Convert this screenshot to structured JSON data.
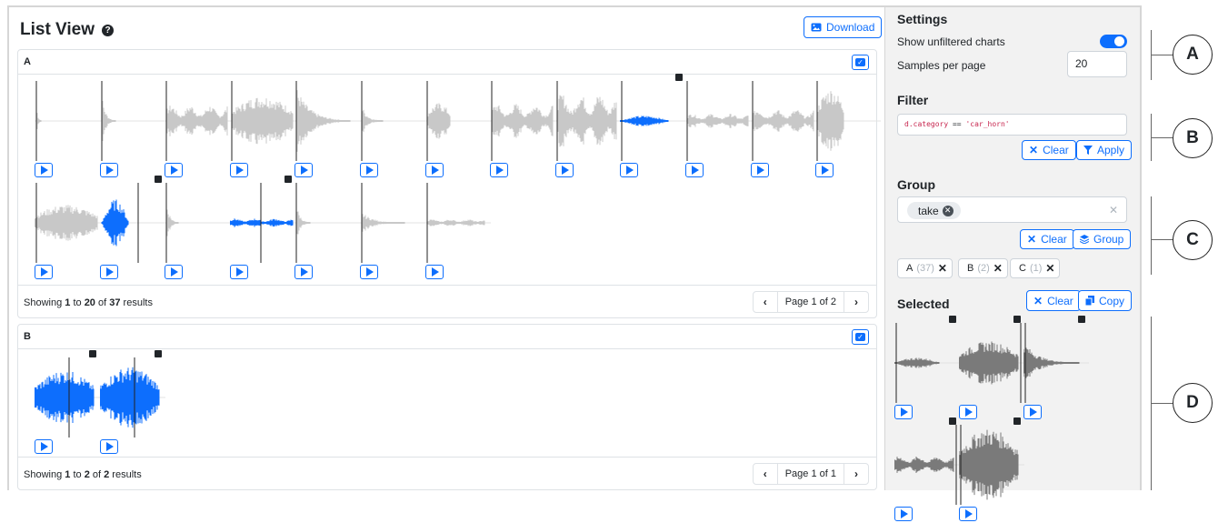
{
  "list_view": {
    "title": "List View",
    "help": "?",
    "download_label": "Download"
  },
  "groups": [
    {
      "label": "A",
      "showing_prefix": "Showing ",
      "showing_from": "1",
      "showing_to": "20",
      "showing_total": "37",
      "page_label": "Page 1 of 2"
    },
    {
      "label": "B",
      "showing_prefix": "Showing ",
      "showing_from": "1",
      "showing_to": "2",
      "showing_total": "2",
      "page_label": "Page 1 of 1"
    }
  ],
  "settings": {
    "title": "Settings",
    "show_unfiltered_label": "Show unfiltered charts",
    "show_unfiltered_on": true,
    "samples_per_page_label": "Samples per page",
    "samples_per_page_value": "20"
  },
  "filter": {
    "title": "Filter",
    "query_var": "d.category",
    "query_op": " == ",
    "query_str": "'car_horn'",
    "clear_label": "Clear",
    "apply_label": "Apply"
  },
  "group": {
    "title": "Group",
    "tag": "take",
    "clear_label": "Clear",
    "group_label": "Group",
    "chips": [
      {
        "name": "A",
        "count": "(37)"
      },
      {
        "name": "B",
        "count": "(2)"
      },
      {
        "name": "C",
        "count": "(1)"
      }
    ]
  },
  "selected": {
    "title": "Selected",
    "clear_label": "Clear",
    "copy_label": "Copy"
  },
  "callouts": [
    "A",
    "B",
    "C",
    "D"
  ],
  "colors": {
    "accent": "#0d6efd",
    "wave_gray": "#c8c8c8",
    "wave_dark": "#7a7a7a"
  }
}
